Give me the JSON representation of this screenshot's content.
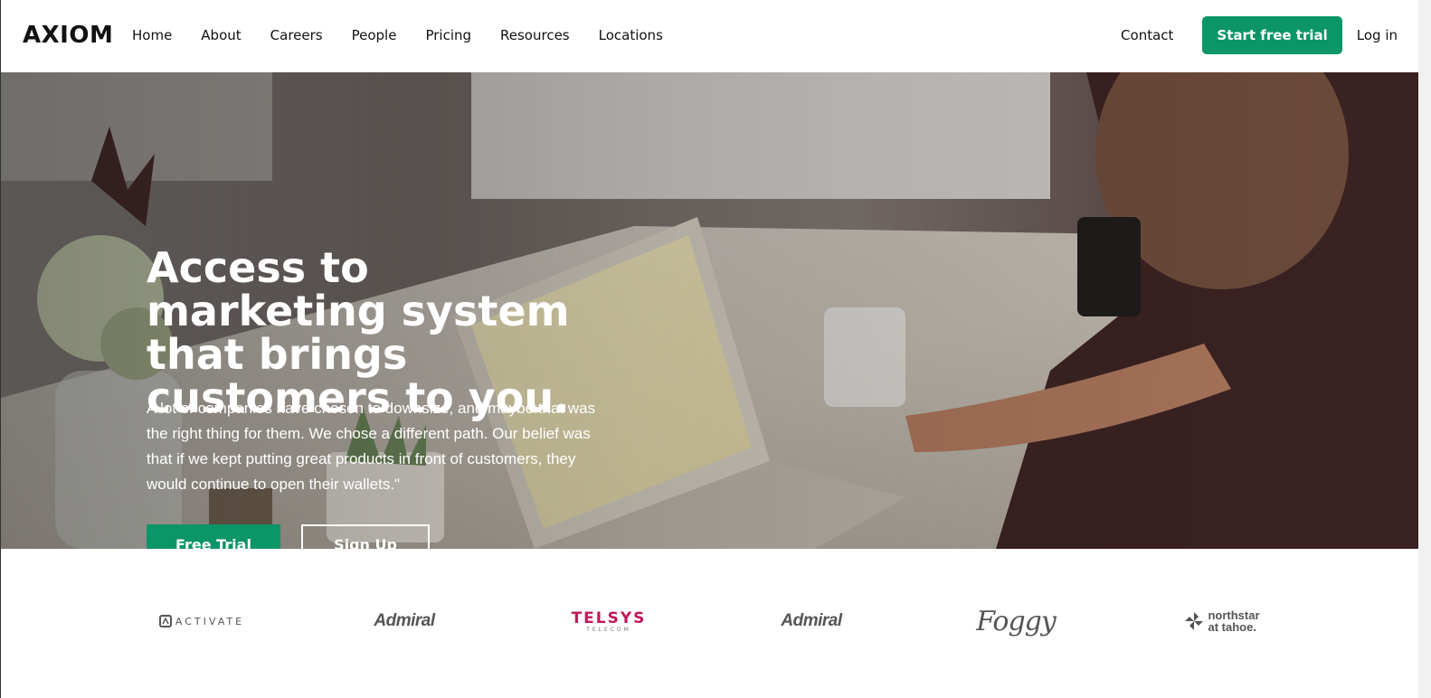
{
  "brand": {
    "name": "AXIOM"
  },
  "nav": {
    "items": [
      {
        "label": "Home"
      },
      {
        "label": "About"
      },
      {
        "label": "Careers"
      },
      {
        "label": "People"
      },
      {
        "label": "Pricing"
      },
      {
        "label": "Resources"
      },
      {
        "label": "Locations"
      }
    ],
    "contact": "Contact",
    "start_trial": "Start free trial",
    "login": "Log in"
  },
  "hero": {
    "headline": "Access to marketing system that brings customers to you.",
    "body": "A lot of companies have chosen to downsize, and maybe that was the right thing for them. We chose a different path. Our belief was that if we kept putting great products in front of customers, they would continue to open their wallets.\"",
    "primary_cta": "Free Trial",
    "secondary_cta": "Sign Up",
    "image": "person-working-on-laptop-photo"
  },
  "logos": {
    "activate": "ACTIVATE",
    "admiral_1": "Admiral",
    "telsys": "TELSYS",
    "telsys_sub": "TELECOM",
    "admiral_2": "Admiral",
    "foggy": "Foggy",
    "northstar_1": "northstar",
    "northstar_2": "at tahoe."
  },
  "colors": {
    "accent": "#0c9567",
    "telsys": "#c2185b",
    "logo_gray": "#555555"
  }
}
